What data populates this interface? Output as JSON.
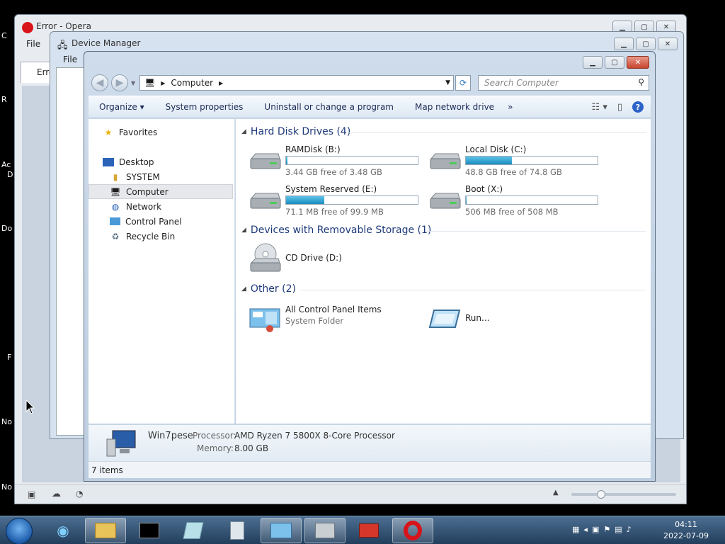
{
  "desktop": {
    "fragments": [
      "C",
      "R",
      "Ac",
      "D",
      "Do",
      "F",
      "No",
      "No"
    ]
  },
  "opera": {
    "title": "Error - Opera",
    "menu_file": "File",
    "tab_label": "Erro"
  },
  "devmgr": {
    "title": "Device Manager",
    "menu_file": "File"
  },
  "explorer": {
    "breadcrumb": "Computer",
    "search_placeholder": "Search Computer",
    "toolbar": {
      "organize": "Organize",
      "system_properties": "System properties",
      "uninstall": "Uninstall or change a program",
      "map_drive": "Map network drive",
      "more": "»"
    },
    "nav": {
      "favorites": "Favorites",
      "desktop": "Desktop",
      "system": "SYSTEM",
      "computer": "Computer",
      "network": "Network",
      "control_panel": "Control Panel",
      "recycle_bin": "Recycle Bin"
    },
    "groups": {
      "hdd": "Hard Disk Drives (4)",
      "removable": "Devices with Removable Storage (1)",
      "other": "Other (2)"
    },
    "drives": [
      {
        "name": "RAMDisk (B:)",
        "free_text": "3.44 GB free of 3.48 GB",
        "used_fraction": 0.01
      },
      {
        "name": "Local Disk (C:)",
        "free_text": "48.8 GB free of 74.8 GB",
        "used_fraction": 0.35
      },
      {
        "name": "System Reserved (E:)",
        "free_text": "71.1 MB free of 99.9 MB",
        "used_fraction": 0.29
      },
      {
        "name": "Boot (X:)",
        "free_text": "506 MB free of 508 MB",
        "used_fraction": 0.004
      }
    ],
    "cd_drive": "CD Drive (D:)",
    "other_items": {
      "all_cp": "All Control Panel Items",
      "all_cp_sub": "System Folder",
      "run": "Run..."
    },
    "details": {
      "computer_name": "Win7pese",
      "processor_label": "Processor:",
      "processor_value": "AMD Ryzen 7 5800X 8-Core Processor",
      "memory_label": "Memory:",
      "memory_value": "8.00 GB"
    },
    "status": "7 items"
  },
  "taskbar": {
    "time": "04:11",
    "date": "2022-07-09"
  },
  "colors": {
    "drive_fill": "#1b8cbe",
    "close_button": "#c8452e",
    "taskbar": "#223e5c"
  }
}
